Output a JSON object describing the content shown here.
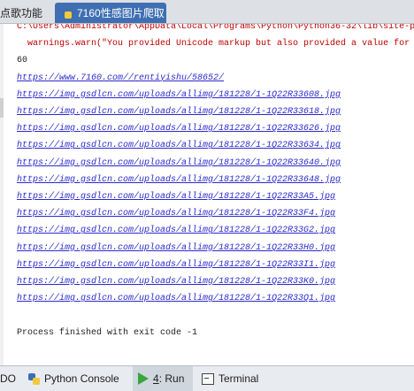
{
  "tabs": [
    {
      "label": "点歌功能"
    },
    {
      "label": "7160性感图片爬取"
    }
  ],
  "console": {
    "lines": [
      {
        "kind": "err",
        "text": "C:\\Users\\Administrator\\AppData\\Local\\Programs\\Python\\Python36-32\\lib\\site-p"
      },
      {
        "kind": "err",
        "text": "  warnings.warn(\"You provided Unicode markup but also provided a value for"
      },
      {
        "kind": "norm",
        "text": "60"
      },
      {
        "kind": "link",
        "text": "https://www.7160.com//rentiyishu/58652/"
      },
      {
        "kind": "link",
        "text": "https://img.gsdlcn.com/uploads/allimg/181228/1-1Q22R33608.jpg"
      },
      {
        "kind": "link",
        "text": "https://img.gsdlcn.com/uploads/allimg/181228/1-1Q22R33618.jpg"
      },
      {
        "kind": "link",
        "text": "https://img.gsdlcn.com/uploads/allimg/181228/1-1Q22R33626.jpg"
      },
      {
        "kind": "link",
        "text": "https://img.gsdlcn.com/uploads/allimg/181228/1-1Q22R33634.jpg"
      },
      {
        "kind": "link",
        "text": "https://img.gsdlcn.com/uploads/allimg/181228/1-1Q22R33640.jpg"
      },
      {
        "kind": "link",
        "text": "https://img.gsdlcn.com/uploads/allimg/181228/1-1Q22R33648.jpg"
      },
      {
        "kind": "link",
        "text": "https://img.gsdlcn.com/uploads/allimg/181228/1-1Q22R33A5.jpg"
      },
      {
        "kind": "link",
        "text": "https://img.gsdlcn.com/uploads/allimg/181228/1-1Q22R33F4.jpg"
      },
      {
        "kind": "link",
        "text": "https://img.gsdlcn.com/uploads/allimg/181228/1-1Q22R33G2.jpg"
      },
      {
        "kind": "link",
        "text": "https://img.gsdlcn.com/uploads/allimg/181228/1-1Q22R33H0.jpg"
      },
      {
        "kind": "link",
        "text": "https://img.gsdlcn.com/uploads/allimg/181228/1-1Q22R33I1.jpg"
      },
      {
        "kind": "link",
        "text": "https://img.gsdlcn.com/uploads/allimg/181228/1-1Q22R33K0.jpg"
      },
      {
        "kind": "link",
        "text": "https://img.gsdlcn.com/uploads/allimg/181228/1-1Q22R33Q1.jpg"
      },
      {
        "kind": "norm",
        "text": ""
      },
      {
        "kind": "norm",
        "text": "Process finished with exit code -1"
      }
    ]
  },
  "bottom_tabs": {
    "todo": "DO",
    "python_console": "Python Console",
    "run_number": "4",
    "run_rest": ": Run",
    "terminal": "Terminal"
  },
  "icons": {
    "tab_python": "python-file-icon",
    "run": "run-icon",
    "terminal": "terminal-icon"
  },
  "colors": {
    "active_tab": "#3f6fb2",
    "error_text": "#c00000",
    "link_text": "#2a2acc"
  }
}
